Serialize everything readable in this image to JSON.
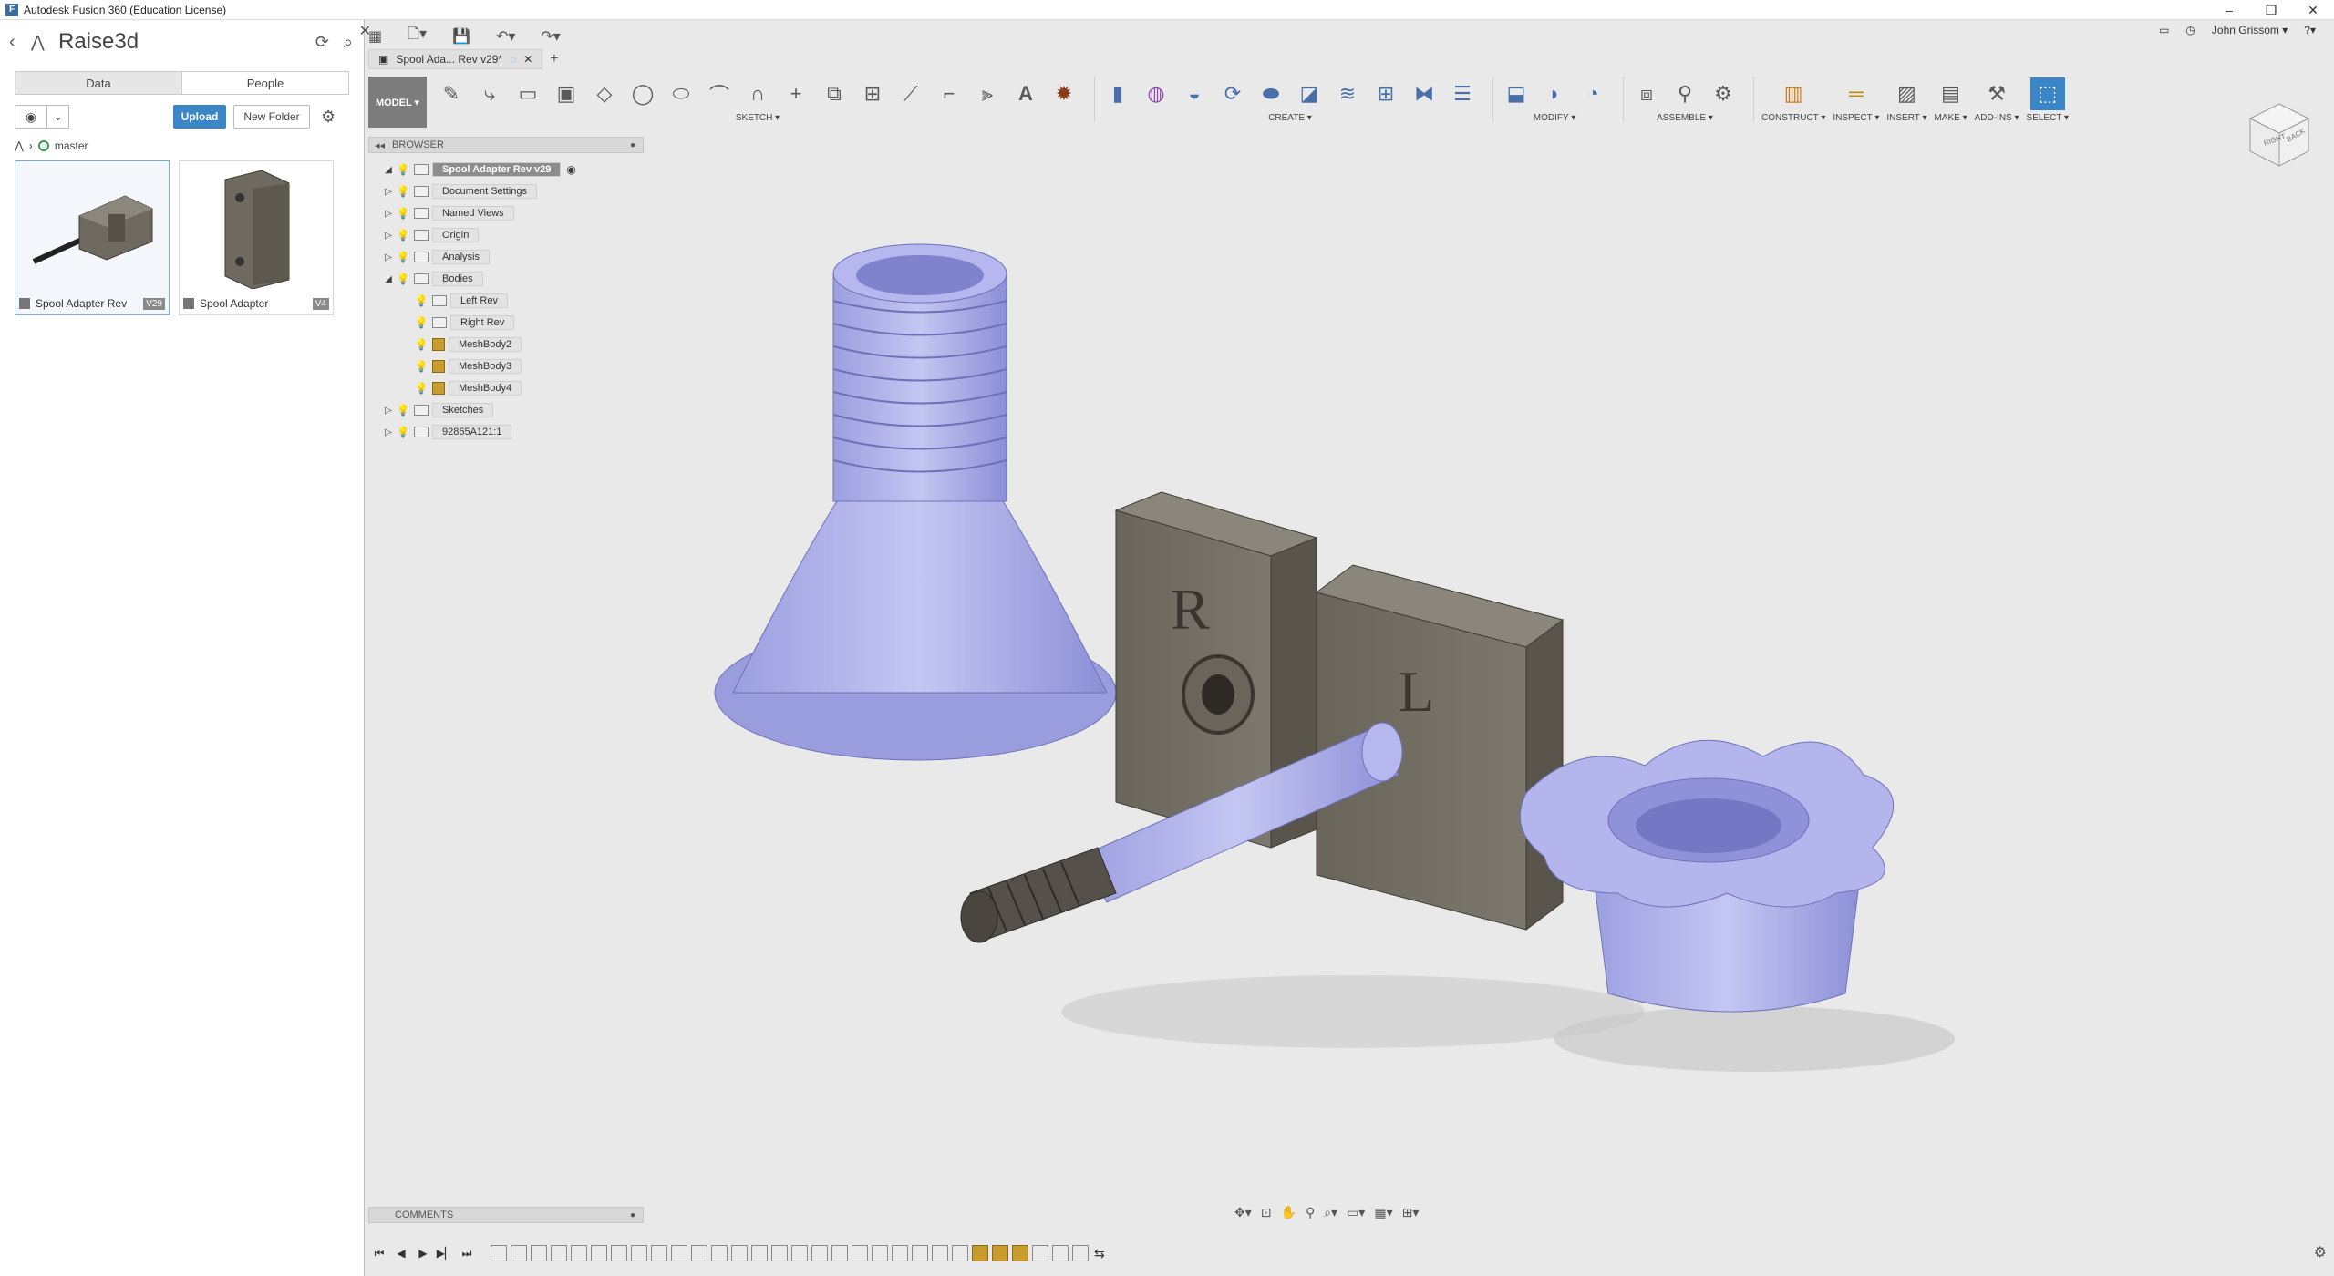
{
  "window": {
    "title": "Autodesk Fusion 360 (Education License)",
    "minimize": "–",
    "restore": "❐",
    "close": "✕"
  },
  "data_panel": {
    "project_title": "Raise3d",
    "tabs": [
      "Data",
      "People"
    ],
    "upload_label": "Upload",
    "new_folder_label": "New Folder",
    "branch": "master",
    "files": [
      {
        "name": "Spool Adapter Rev",
        "version": "V29"
      },
      {
        "name": "Spool Adapter",
        "version": "V4"
      }
    ]
  },
  "document_tab": {
    "label": "Spool Ada... Rev v29*"
  },
  "user": {
    "name": "John Grissom ▾"
  },
  "toolbar": {
    "workspace": "MODEL ▾",
    "groups": [
      "SKETCH ▾",
      "CREATE ▾",
      "MODIFY ▾",
      "ASSEMBLE ▾",
      "CONSTRUCT ▾",
      "INSPECT ▾",
      "INSERT ▾",
      "MAKE ▾",
      "ADD-INS ▾",
      "SELECT ▾"
    ]
  },
  "viewcube": {
    "right": "RIGHT",
    "back": "BACK"
  },
  "browser": {
    "title": "BROWSER",
    "root": "Spool Adapter Rev v29",
    "nodes": [
      {
        "label": "Document Settings",
        "level": 1,
        "expand": "▷"
      },
      {
        "label": "Named Views",
        "level": 1,
        "expand": "▷"
      },
      {
        "label": "Origin",
        "level": 1,
        "expand": "▷"
      },
      {
        "label": "Analysis",
        "level": 1,
        "expand": "▷"
      },
      {
        "label": "Bodies",
        "level": 1,
        "expand": "◢"
      },
      {
        "label": "Left Rev",
        "level": 2,
        "expand": ""
      },
      {
        "label": "Right Rev",
        "level": 2,
        "expand": ""
      },
      {
        "label": "MeshBody2",
        "level": 2,
        "expand": ""
      },
      {
        "label": "MeshBody3",
        "level": 2,
        "expand": ""
      },
      {
        "label": "MeshBody4",
        "level": 2,
        "expand": ""
      },
      {
        "label": "Sketches",
        "level": 1,
        "expand": "▷"
      },
      {
        "label": "92865A121:1",
        "level": 1,
        "expand": "▷"
      }
    ]
  },
  "comments": {
    "title": "COMMENTS"
  },
  "model_text": {
    "right_label": "R",
    "left_label": "L"
  },
  "colors": {
    "mesh": "#a9abe6",
    "metal": "#6f6a60",
    "accent": "#3b86c6"
  }
}
